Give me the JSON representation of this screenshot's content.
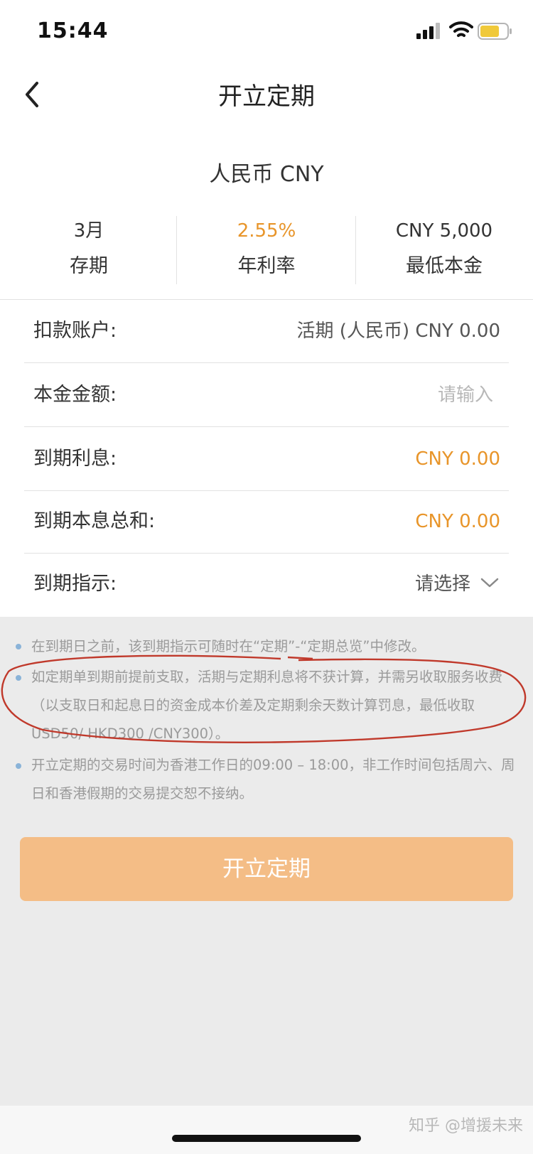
{
  "status_bar": {
    "time": "15:44"
  },
  "nav": {
    "title": "开立定期"
  },
  "currency": "人民币 CNY",
  "stats": [
    {
      "value": "3月",
      "label": "存期"
    },
    {
      "value": "2.55%",
      "label": "年利率"
    },
    {
      "value": "CNY 5,000",
      "label": "最低本金"
    }
  ],
  "form": {
    "debit_account": {
      "label": "扣款账户:",
      "value": "活期 (人民币) CNY 0.00"
    },
    "principal": {
      "label": "本金金额:",
      "placeholder": "请输入"
    },
    "maturity_interest": {
      "label": "到期利息:",
      "value": "CNY 0.00"
    },
    "maturity_total": {
      "label": "到期本息总和:",
      "value": "CNY 0.00"
    },
    "maturity_instruction": {
      "label": "到期指示:",
      "value": "请选择"
    }
  },
  "notes": [
    "在到期日之前，该到期指示可随时在“定期”-“定期总览”中修改。",
    "如定期单到期前提前支取，活期与定期利息将不获计算，并需另收取服务收费（以支取日和起息日的资金成本价差及定期剩余天数计算罚息，最低收取USD50/ HKD300 /CNY300）。",
    "开立定期的交易时间为香港工作日的09:00 – 18:00，非工作时间包括周六、周日和香港假期的交易提交恕不接纳。"
  ],
  "submit_label": "开立定期",
  "watermark": "知乎 @增援未来",
  "colors": {
    "accent": "#e8952a",
    "button": "#f4bd86",
    "annotation": "#c0392b"
  },
  "icons": [
    "back-arrow-icon",
    "signal-icon",
    "wifi-icon",
    "battery-icon",
    "chevron-down-icon"
  ]
}
